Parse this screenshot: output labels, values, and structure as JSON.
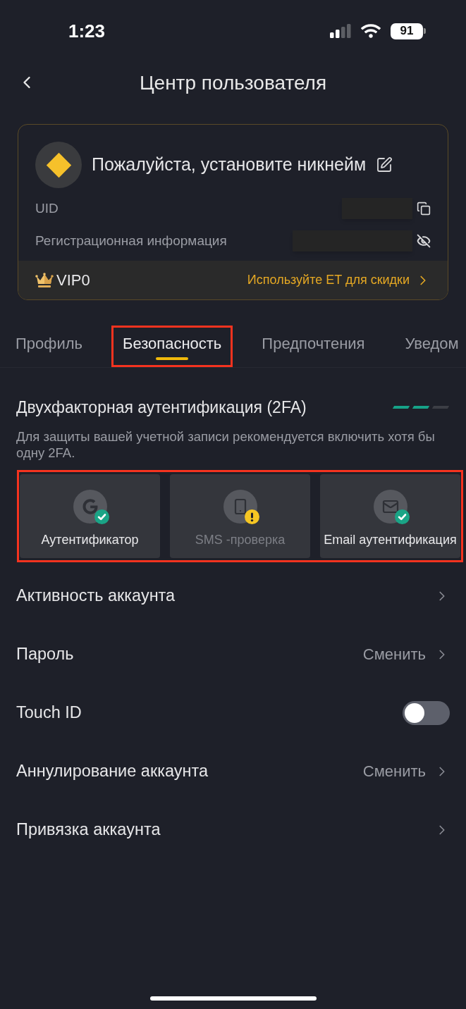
{
  "status_bar": {
    "time": "1:23",
    "battery": "91"
  },
  "header": {
    "title": "Центр пользователя"
  },
  "profile_card": {
    "nickname": "Пожалуйста, установите никнейм",
    "rows": [
      {
        "kind": "copy",
        "label": "UID",
        "redacted": true
      },
      {
        "kind": "hide",
        "label": "Регистрационная информация",
        "redacted": true
      }
    ],
    "vip": {
      "level_label": "VIP0",
      "promo": "Используйте ET для скидки"
    }
  },
  "tabs": [
    {
      "label": "Профиль",
      "selected": false,
      "highlighted": false
    },
    {
      "label": "Безопасность",
      "selected": true,
      "highlighted": true
    },
    {
      "label": "Предпочтения",
      "selected": false,
      "highlighted": false
    },
    {
      "label": "Уведом",
      "selected": false,
      "highlighted": false
    }
  ],
  "two_factor": {
    "title": "Двухфакторная аутентификация (2FA)",
    "strength": [
      {
        "filled": true
      },
      {
        "filled": true
      },
      {
        "filled": false
      }
    ],
    "description": "Для защиты вашей учетной записи рекомендуется включить хотя бы одну 2FA.",
    "highlighted": true,
    "methods": [
      {
        "kind": "authenticator",
        "label": "Аутентификатор",
        "enabled": true
      },
      {
        "kind": "sms",
        "label": "SMS -проверка",
        "enabled": false
      },
      {
        "kind": "email",
        "label": "Email аутентификация",
        "enabled": true
      }
    ]
  },
  "security_items": [
    {
      "kind": "link",
      "label": "Активность аккаунта"
    },
    {
      "kind": "link",
      "label": "Пароль",
      "value": "Сменить"
    },
    {
      "kind": "toggle",
      "label": "Touch ID",
      "on": false
    },
    {
      "kind": "link",
      "label": "Аннулирование аккаунта",
      "value": "Сменить"
    },
    {
      "kind": "link",
      "label": "Привязка аккаунта"
    }
  ]
}
